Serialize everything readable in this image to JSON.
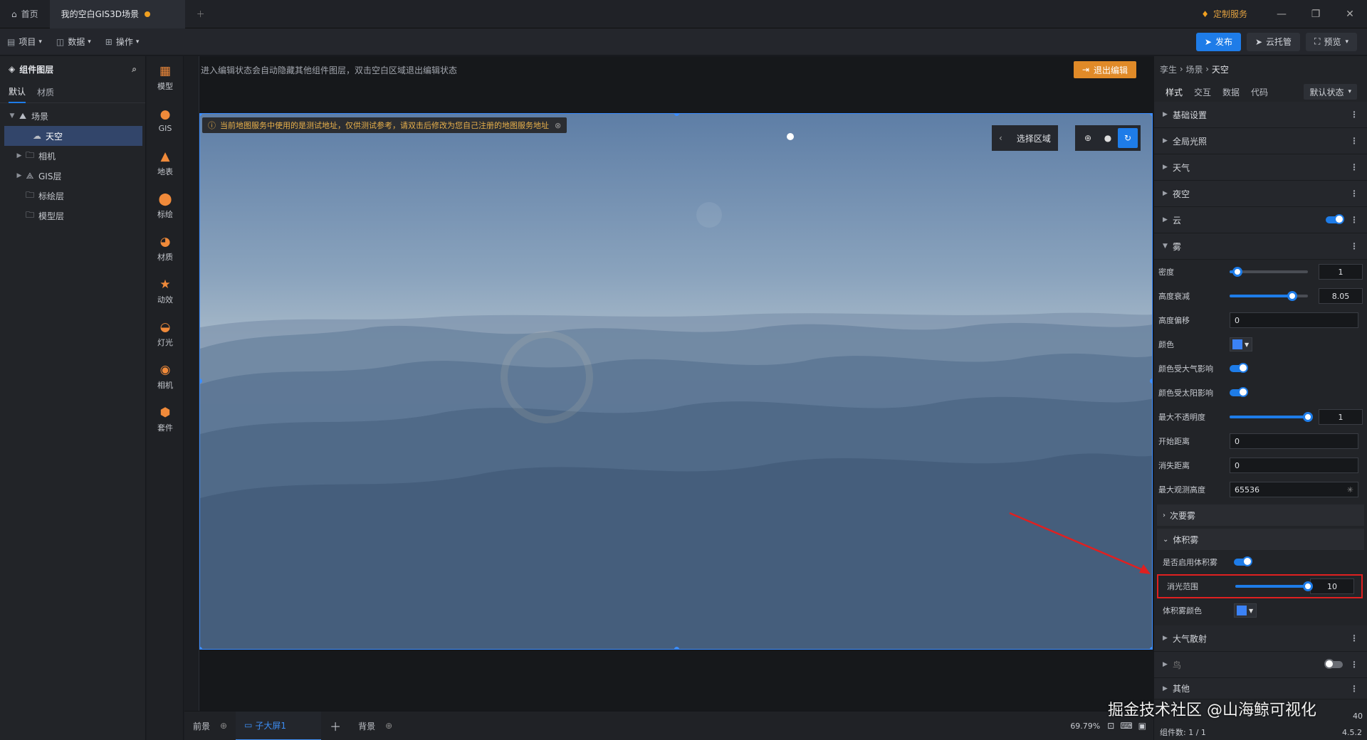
{
  "titlebar": {
    "home_tab": "首页",
    "doc_tab": "我的空白GIS3D场景",
    "custom_service": "定制服务"
  },
  "menubar": {
    "items": [
      "项目",
      "数据",
      "操作"
    ],
    "publish": "发布",
    "cloud_host": "云托管",
    "preview": "预览"
  },
  "left_panel": {
    "title": "组件图层",
    "tabs": [
      "默认",
      "材质"
    ],
    "tree": [
      {
        "label": "场景",
        "level": 0,
        "expanded": true
      },
      {
        "label": "天空",
        "level": 1,
        "selected": true
      },
      {
        "label": "相机",
        "level": 1
      },
      {
        "label": "GIS层",
        "level": 1
      },
      {
        "label": "标绘层",
        "level": 1
      },
      {
        "label": "模型层",
        "level": 1
      }
    ]
  },
  "icon_bar": [
    {
      "label": "模型",
      "icon": "model-icon"
    },
    {
      "label": "GIS",
      "icon": "gis-icon"
    },
    {
      "label": "地表",
      "icon": "terrain-icon"
    },
    {
      "label": "标绘",
      "icon": "pin-icon"
    },
    {
      "label": "材质",
      "icon": "material-icon"
    },
    {
      "label": "动效",
      "icon": "effect-icon"
    },
    {
      "label": "灯光",
      "icon": "light-icon"
    },
    {
      "label": "相机",
      "icon": "camera-icon"
    },
    {
      "label": "套件",
      "icon": "kit-icon"
    }
  ],
  "canvas": {
    "hint": "进入编辑状态会自动隐藏其他组件图层，双击空白区域退出编辑状态",
    "exit_edit": "退出编辑",
    "warning": "当前地图服务中使用的是测试地址，仅供测试参考，请双击后修改为您自己注册的地图服务地址",
    "select_area": "选择区域"
  },
  "bottom_bar": {
    "tabs": [
      "前景",
      "子大屏1",
      "背景"
    ],
    "zoom": "69.79%"
  },
  "right_panel": {
    "breadcrumb": [
      "孪生",
      "场景",
      "天空"
    ],
    "tabs": [
      "样式",
      "交互",
      "数据",
      "代码"
    ],
    "state": "默认状态",
    "sections_top": [
      "基础设置",
      "全局光照",
      "天气",
      "夜空",
      "云",
      "雾"
    ],
    "fog": {
      "density_label": "密度",
      "density": "1",
      "density_pct": 0.1,
      "height_falloff_label": "高度衰减",
      "height_falloff": "8.05",
      "height_falloff_pct": 0.8,
      "height_offset_label": "高度偏移",
      "height_offset": "0",
      "color_label": "颜色",
      "atmo_label": "颜色受大气影响",
      "sun_label": "颜色受太阳影响",
      "max_opacity_label": "最大不透明度",
      "max_opacity": "1",
      "max_opacity_pct": 1.0,
      "start_dist_label": "开始距离",
      "start_dist": "0",
      "cutoff_label": "消失距离",
      "cutoff": "0",
      "max_height_label": "最大观测高度",
      "max_height": "65536"
    },
    "secondary_fog": "次要雾",
    "volumetric": {
      "title": "体积雾",
      "enable_label": "是否启用体积雾",
      "extinction_label": "消光范围",
      "extinction": "10",
      "extinction_pct": 1.0,
      "color_label": "体积雾颜色"
    },
    "sections_bottom": [
      "大气散射",
      "鸟",
      "其他"
    ],
    "footer": "组件数: 1 / 1",
    "version": "4.5.2",
    "fps": "40"
  },
  "watermark": "掘金技术社区 @山海鲸可视化"
}
